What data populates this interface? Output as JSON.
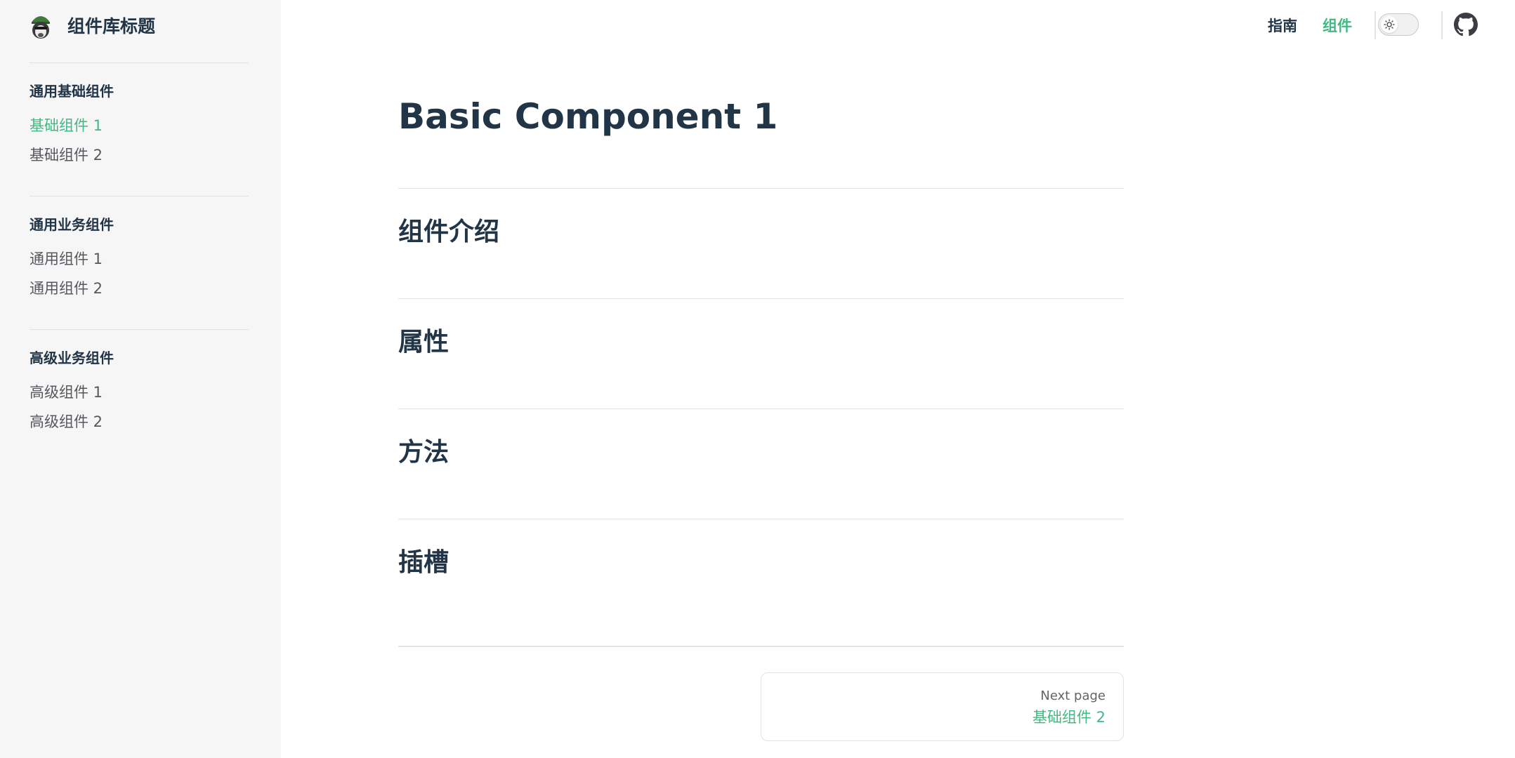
{
  "brand": {
    "title": "组件库标题"
  },
  "sidebar": {
    "groups": [
      {
        "title": "通用基础组件",
        "items": [
          {
            "label": "基础组件 1",
            "active": true
          },
          {
            "label": "基础组件 2"
          }
        ]
      },
      {
        "title": "通用业务组件",
        "items": [
          {
            "label": "通用组件 1"
          },
          {
            "label": "通用组件 2"
          }
        ]
      },
      {
        "title": "高级业务组件",
        "items": [
          {
            "label": "高级组件 1"
          },
          {
            "label": "高级组件 2"
          }
        ]
      }
    ]
  },
  "nav": {
    "links": [
      {
        "label": "指南"
      },
      {
        "label": "组件",
        "active": true
      }
    ],
    "theme_toggle_icon": "sun-icon",
    "social_icon": "github-icon"
  },
  "main": {
    "title": "Basic Component 1",
    "sections": [
      "组件介绍",
      "属性",
      "方法",
      "插槽"
    ]
  },
  "pager": {
    "next_desc": "Next page",
    "next_title": "基础组件 2"
  },
  "colors": {
    "accent": "#42b883",
    "text": "#213547",
    "sidebar_bg": "#f6f6f7",
    "divider": "#e2e2e3"
  }
}
